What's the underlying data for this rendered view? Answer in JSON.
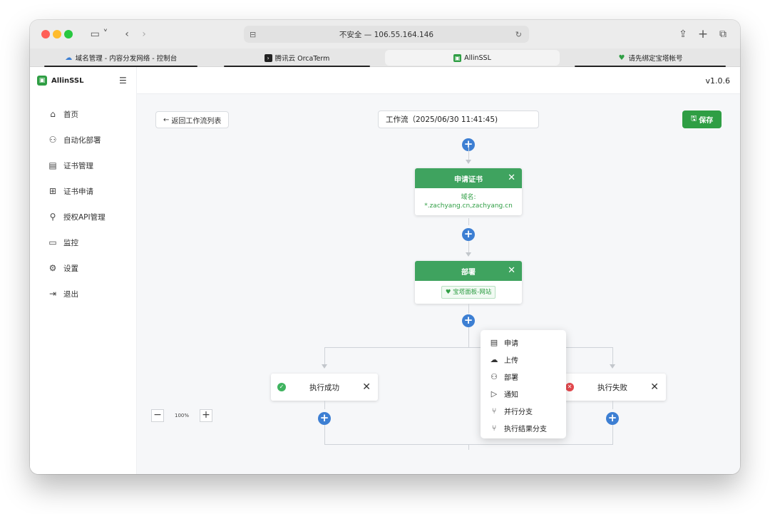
{
  "browser": {
    "address": "不安全 — 106.55.164.146",
    "tabs": [
      {
        "label": "域名管理 - 内容分发网络 - 控制台",
        "active": false
      },
      {
        "label": "腾讯云 OrcaTerm",
        "active": false
      },
      {
        "label": "AllinSSL",
        "active": true
      },
      {
        "label": "请先绑定宝塔帐号",
        "active": false
      }
    ]
  },
  "sidebar": {
    "brand": "AllinSSL",
    "items": [
      {
        "label": "首页",
        "icon": "home-icon"
      },
      {
        "label": "自动化部署",
        "icon": "deploy-icon"
      },
      {
        "label": "证书管理",
        "icon": "cert-icon"
      },
      {
        "label": "证书申请",
        "icon": "plus-square-icon"
      },
      {
        "label": "授权API管理",
        "icon": "api-icon"
      },
      {
        "label": "监控",
        "icon": "monitor-icon"
      },
      {
        "label": "设置",
        "icon": "settings-icon"
      },
      {
        "label": "退出",
        "icon": "logout-icon"
      }
    ]
  },
  "header": {
    "version": "v1.0.6"
  },
  "toolbar": {
    "back_label": "返回工作流列表",
    "workflow_name": "工作流（2025/06/30 11:41:45)",
    "save_label": "保存"
  },
  "flow": {
    "apply_node": {
      "title": "申请证书",
      "domain_label": "域名:",
      "domains": "*.zachyang.cn,zachyang.cn"
    },
    "deploy_node": {
      "title": "部署",
      "target": "宝塔面板-网站"
    },
    "success_branch": "执行成功",
    "fail_branch": "执行失败"
  },
  "add_menu": {
    "items": [
      {
        "label": "申请",
        "icon": "apply-icon"
      },
      {
        "label": "上传",
        "icon": "upload-icon"
      },
      {
        "label": "部署",
        "icon": "deploy-icon"
      },
      {
        "label": "通知",
        "icon": "send-icon"
      },
      {
        "label": "并行分支",
        "icon": "branch-icon"
      },
      {
        "label": "执行结果分支",
        "icon": "result-branch-icon"
      }
    ]
  },
  "zoom": {
    "value": "100%"
  },
  "colors": {
    "accent": "#2f9e44",
    "node_header": "#3fa35f",
    "plus": "#3d7fd3"
  }
}
